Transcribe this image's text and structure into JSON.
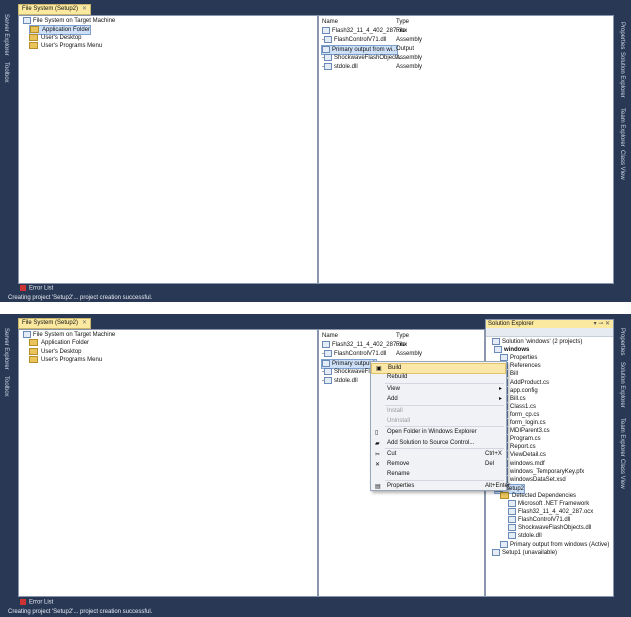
{
  "top": {
    "tab": "File System (Setup2)",
    "tree": [
      "File System on Target Machine",
      "Application Folder",
      "User's Desktop",
      "User's Programs Menu"
    ],
    "columns": [
      "Name",
      "Type"
    ],
    "files": [
      {
        "name": "Flash32_11_4_402_287.ocx",
        "type": "File"
      },
      {
        "name": "FlashControlV71.dll",
        "type": "Assembly"
      },
      {
        "name": "Primary output from wi...",
        "type": "Output"
      },
      {
        "name": "ShockwaveFlashObjects...",
        "type": "Assembly"
      },
      {
        "name": "stdole.dll",
        "type": "Assembly"
      }
    ],
    "left_strip": [
      "Server Explorer",
      "Toolbox"
    ],
    "right_strip": [
      "Properties",
      "Solution Explorer",
      "Team Explorer",
      "Class View"
    ],
    "error_list": "Error List",
    "status": "Creating project 'Setup2'... project creation successful."
  },
  "bottom": {
    "tab": "File System (Setup2)",
    "tree": [
      "File System on Target Machine",
      "Application Folder",
      "User's Desktop",
      "User's Programs Menu"
    ],
    "columns": [
      "Name",
      "Type"
    ],
    "files": [
      {
        "name": "Flash32_11_4_402_287.ocx",
        "type": "File"
      },
      {
        "name": "FlashControlV71.dll",
        "type": "Assembly"
      },
      {
        "name": "Primary output fr",
        "type": ""
      },
      {
        "name": "ShockwaveFlashO",
        "type": ""
      },
      {
        "name": "stdole.dll",
        "type": ""
      }
    ],
    "context_menu": [
      {
        "label": "Build",
        "shortcut": "",
        "icon": "build-icon"
      },
      {
        "label": "Rebuild",
        "shortcut": ""
      },
      {
        "label": "View",
        "shortcut": "",
        "submenu": true
      },
      {
        "label": "Add",
        "shortcut": "",
        "submenu": true
      },
      {
        "label": "Install",
        "disabled": true
      },
      {
        "label": "Uninstall",
        "disabled": true
      },
      {
        "label": "Open Folder in Windows Explorer",
        "icon": "folder-open-icon"
      },
      {
        "label": "Add Solution to Source Control...",
        "icon": "source-control-icon"
      },
      {
        "label": "Cut",
        "shortcut": "Ctrl+X",
        "icon": "cut-icon"
      },
      {
        "label": "Remove",
        "shortcut": "Del",
        "icon": "remove-icon"
      },
      {
        "label": "Rename",
        "shortcut": ""
      },
      {
        "label": "Properties",
        "shortcut": "Alt+Enter",
        "icon": "properties-icon"
      }
    ],
    "solution_explorer": {
      "title": "Solution Explorer",
      "items": [
        "Solution 'windows' (2 projects)",
        "windows",
        "Properties",
        "References",
        "Bill",
        "AddProduct.cs",
        "app.config",
        "Bill.cs",
        "Class1.cs",
        "form_cp.cs",
        "form_login.cs",
        "MDIParent3.cs",
        "Program.cs",
        "Report.cs",
        "ViewDetail.cs",
        "windows.mdf",
        "windows_TemporaryKey.pfx",
        "windowsDataSet.xsd",
        "Setup2",
        "Detected Dependencies",
        "Microsoft .NET Framework",
        "Flash32_11_4_402_287.ocx",
        "FlashControlV71.dll",
        "ShockwaveFlashObjects.dll",
        "stdole.dll",
        "Primary output from windows (Active)",
        "Setup1 (unavailable)"
      ]
    },
    "left_strip": [
      "Server Explorer",
      "Toolbox"
    ],
    "right_strip": [
      "Properties",
      "Solution Explorer",
      "Team Explorer",
      "Class View"
    ],
    "error_list": "Error List",
    "status": "Creating project 'Setup2'... project creation successful."
  }
}
